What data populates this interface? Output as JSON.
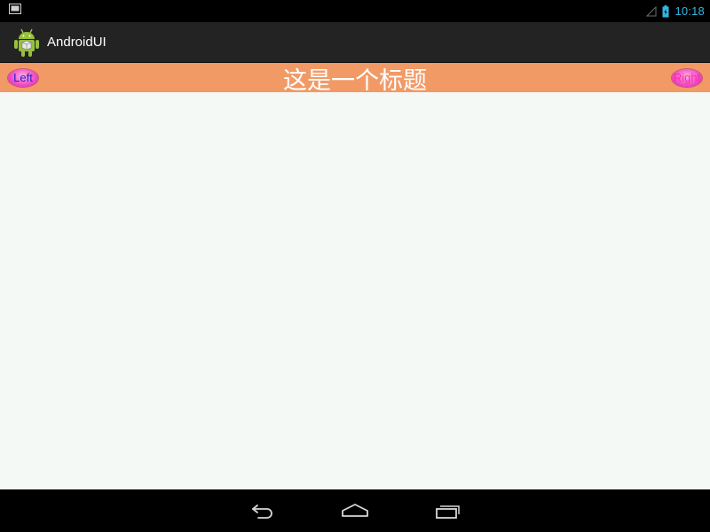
{
  "status_bar": {
    "time": "10:18",
    "icons": [
      "screenshot-icon",
      "signal-icon",
      "battery-icon"
    ],
    "accent_color": "#33b5e5"
  },
  "action_bar": {
    "app_icon": "android-robot-icon",
    "title": "AndroidUI"
  },
  "title_bar": {
    "title": "这是一个标题",
    "left_button": "Left",
    "right_button": "Right",
    "background_color": "#f29a66"
  },
  "navigation_bar": {
    "buttons": [
      "back-icon",
      "home-icon",
      "recent-apps-icon"
    ]
  }
}
